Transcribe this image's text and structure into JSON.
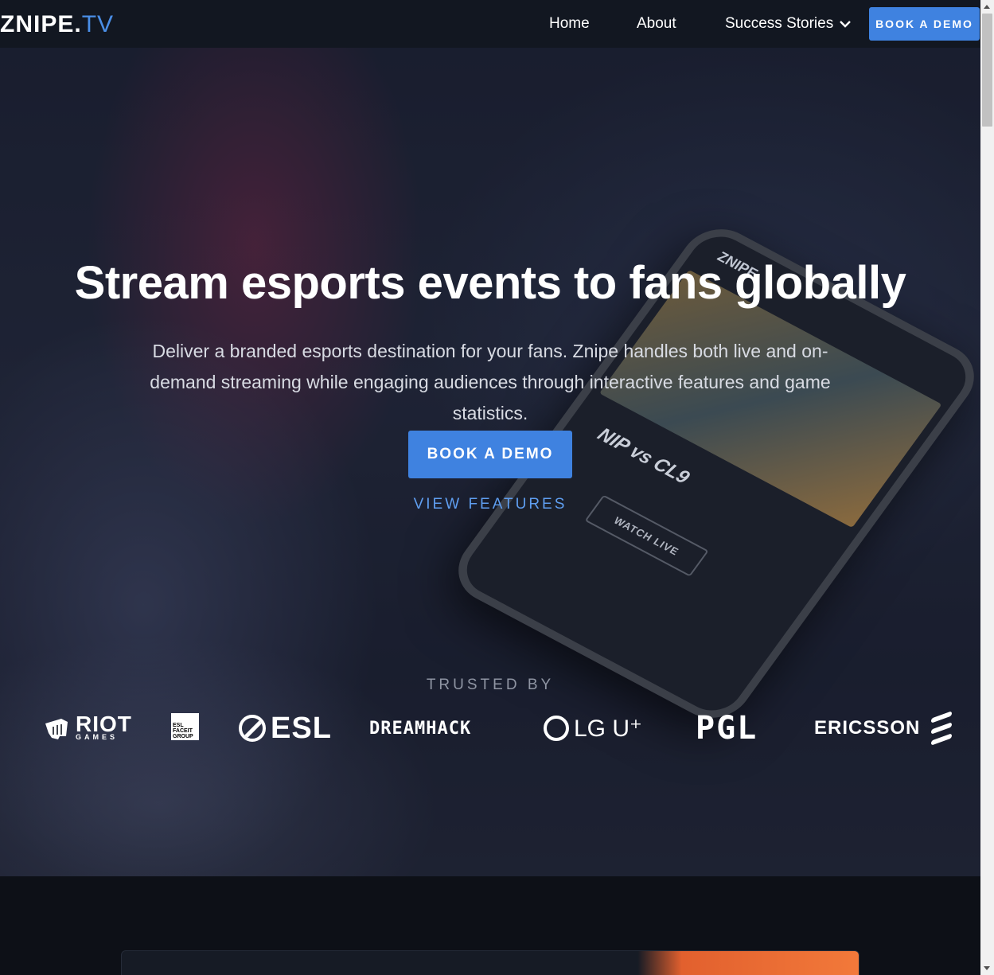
{
  "nav": {
    "logo_main": "ZNIPE.",
    "logo_tv": "TV",
    "home": "Home",
    "about": "About",
    "success_stories": "Success Stories",
    "book_demo": "BOOK A DEMO"
  },
  "hero": {
    "headline": "Stream esports events to fans globally",
    "subtitle": "Deliver a branded esports destination for your fans. Znipe handles both live and on-demand streaming while engaging audiences through interactive features and game statistics.",
    "cta": "BOOK A DEMO",
    "view_features": "VIEW FEATURES",
    "trusted_by": "TRUSTED BY"
  },
  "phone": {
    "brand": "ZNIPE",
    "match": "NIP vs CL9",
    "watch_live": "WATCH LIVE"
  },
  "logos": {
    "riot": "RIOT",
    "riot_sub": "GAMES",
    "esl_box": "ESL FACEIT GROUP",
    "esl": "ESL",
    "dreamhack": "DREAMHACK",
    "lgu": "LG U⁺",
    "pgl": "PGL",
    "ericsson": "ERICSSON"
  },
  "colors": {
    "accent": "#3f82e0",
    "link": "#5f9ef0",
    "nav_bg": "#121721"
  }
}
